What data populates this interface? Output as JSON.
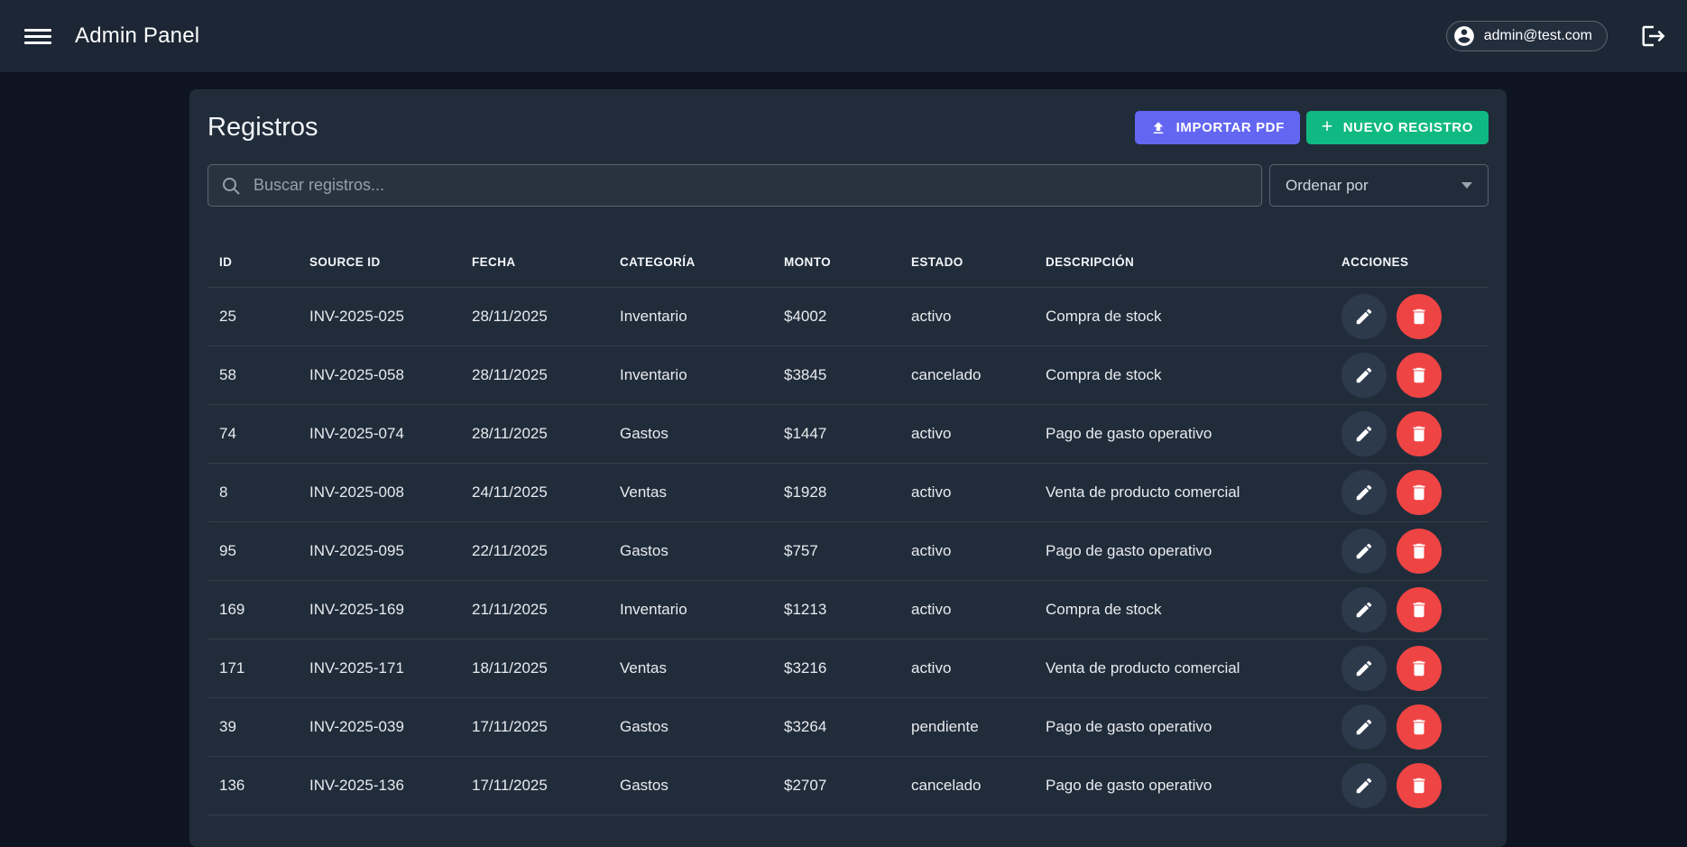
{
  "topbar": {
    "title": "Admin Panel",
    "user_email": "admin@test.com"
  },
  "page": {
    "title": "Registros",
    "import_button_label": "IMPORTAR PDF",
    "new_button_label": "NUEVO REGISTRO",
    "new_button_plus": "+"
  },
  "toolbar": {
    "search_placeholder": "Buscar registros...",
    "sort_selected_label": "Ordenar por"
  },
  "table": {
    "columns": [
      "ID",
      "SOURCE ID",
      "FECHA",
      "CATEGORÍA",
      "MONTO",
      "ESTADO",
      "DESCRIPCIÓN",
      "ACCIONES"
    ],
    "rows": [
      {
        "id": "25",
        "source_id": "INV-2025-025",
        "fecha": "28/11/2025",
        "categoria": "Inventario",
        "monto": "$4002",
        "estado": "activo",
        "descripcion": "Compra de stock"
      },
      {
        "id": "58",
        "source_id": "INV-2025-058",
        "fecha": "28/11/2025",
        "categoria": "Inventario",
        "monto": "$3845",
        "estado": "cancelado",
        "descripcion": "Compra de stock"
      },
      {
        "id": "74",
        "source_id": "INV-2025-074",
        "fecha": "28/11/2025",
        "categoria": "Gastos",
        "monto": "$1447",
        "estado": "activo",
        "descripcion": "Pago de gasto operativo"
      },
      {
        "id": "8",
        "source_id": "INV-2025-008",
        "fecha": "24/11/2025",
        "categoria": "Ventas",
        "monto": "$1928",
        "estado": "activo",
        "descripcion": "Venta de producto comercial"
      },
      {
        "id": "95",
        "source_id": "INV-2025-095",
        "fecha": "22/11/2025",
        "categoria": "Gastos",
        "monto": "$757",
        "estado": "activo",
        "descripcion": "Pago de gasto operativo"
      },
      {
        "id": "169",
        "source_id": "INV-2025-169",
        "fecha": "21/11/2025",
        "categoria": "Inventario",
        "monto": "$1213",
        "estado": "activo",
        "descripcion": "Compra de stock"
      },
      {
        "id": "171",
        "source_id": "INV-2025-171",
        "fecha": "18/11/2025",
        "categoria": "Ventas",
        "monto": "$3216",
        "estado": "activo",
        "descripcion": "Venta de producto comercial"
      },
      {
        "id": "39",
        "source_id": "INV-2025-039",
        "fecha": "17/11/2025",
        "categoria": "Gastos",
        "monto": "$3264",
        "estado": "pendiente",
        "descripcion": "Pago de gasto operativo"
      },
      {
        "id": "136",
        "source_id": "INV-2025-136",
        "fecha": "17/11/2025",
        "categoria": "Gastos",
        "monto": "$2707",
        "estado": "cancelado",
        "descripcion": "Pago de gasto operativo"
      }
    ]
  },
  "icons": {
    "menu": "hamburger-menu",
    "account": "account-circle",
    "logout": "logout-arrow",
    "upload": "upload-arrow",
    "search": "magnifier",
    "caret": "caret-down",
    "edit": "pencil",
    "delete": "trash"
  },
  "colors": {
    "topbar_bg": "#1c2634",
    "page_bg": "#0e1421",
    "card_bg": "#212c3b",
    "accent_import": "#6366f1",
    "accent_new": "#10b981",
    "accent_delete": "#ef4444",
    "edit_circle_bg": "#2d3a4b",
    "row_border": "#343f4c"
  }
}
